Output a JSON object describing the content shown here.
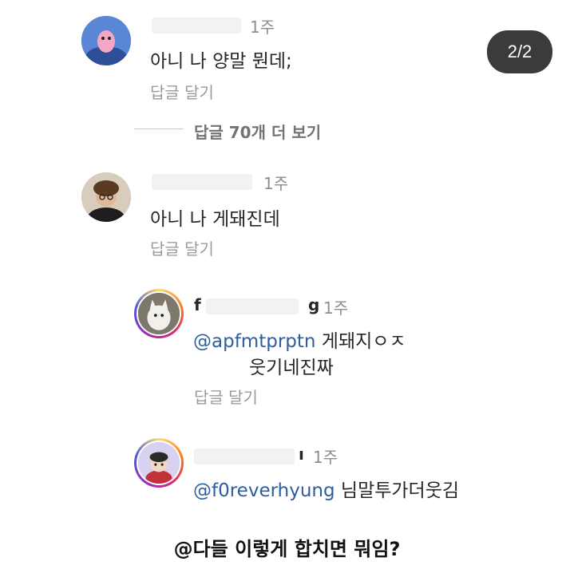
{
  "counter": "2/2",
  "comments": [
    {
      "time": "1주",
      "text": "아니 나 양말 뭔데;",
      "reply_label": "답글 달기"
    },
    {
      "view_more": "답글 70개 더 보기"
    },
    {
      "time": "1주",
      "text": "아니 나 게돼진데",
      "reply_label": "답글 달기"
    },
    {
      "username_start": "f",
      "username_end": "g",
      "time": "1주",
      "mention": "@apfmtprptn",
      "text_line1": " 게돼지ㅇㅈ",
      "text_line2": "웃기네진짜",
      "reply_label": "답글 달기"
    },
    {
      "username_end": "ı",
      "time": "1주",
      "mention": "@f0reverhyung",
      "text": " 님말투가더웃김"
    }
  ],
  "caption": "@다들 이렇게 합치면 뭐임?"
}
